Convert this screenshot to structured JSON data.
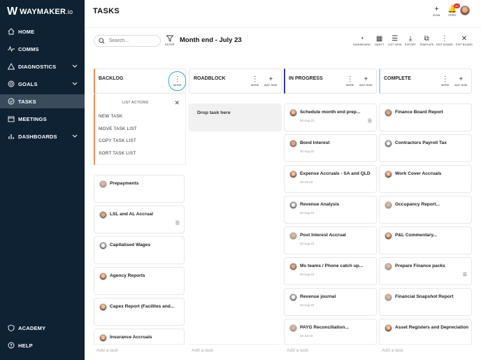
{
  "app": {
    "logo_mark": "W",
    "logo_name": "WAYMAKER",
    "logo_suffix": ".io"
  },
  "sidebar": {
    "items": [
      {
        "label": "HOME",
        "icon": "home-icon"
      },
      {
        "label": "COMMS",
        "icon": "pulse-icon"
      },
      {
        "label": "DIAGNOSTICS",
        "icon": "triangle-icon"
      },
      {
        "label": "GOALS",
        "icon": "target-icon"
      },
      {
        "label": "TASKS",
        "icon": "check-icon",
        "active": true
      },
      {
        "label": "MEETINGS",
        "icon": "calendar-icon"
      },
      {
        "label": "DASHBOARDS",
        "icon": "bar-chart-icon"
      },
      {
        "label": "ACADEMY",
        "icon": "shield-icon"
      },
      {
        "label": "HELP",
        "icon": "help-icon"
      }
    ]
  },
  "header": {
    "title": "TASKS",
    "goal_label": "GOAL",
    "feed_label": "FEED",
    "feed_badge": "62"
  },
  "toolbar": {
    "search_placeholder": "Search...",
    "filter_label": "FILTER",
    "board_title": "Month end - July 23",
    "tools": [
      "DASHBOARD",
      "GANTT",
      "LIST VIEW",
      "EXPORT",
      "TEMPLATE",
      "EDIT BOARD",
      "EXIT BOARD"
    ]
  },
  "columns": [
    {
      "name": "BACKLOG",
      "more": "MORE",
      "color": "#e8905a"
    },
    {
      "name": "ROADBLOCK",
      "more": "MORE",
      "add": "ADD TASK",
      "color": "#ffffff"
    },
    {
      "name": "IN PROGRESS",
      "more": "MORE",
      "add": "ADD TASK",
      "color": "#3b3a8f"
    },
    {
      "name": "COMPLETE",
      "more": "MORE",
      "add": "ADD TASK",
      "color": "#9fd6ea"
    }
  ],
  "list_actions": {
    "header": "LIST ACTIONS",
    "items": [
      "NEW TASK",
      "MOVE TASK LIST",
      "COPY TASK LIST",
      "SORT TASK LIST"
    ]
  },
  "backlog_cards": [
    {
      "title": "Prepayments",
      "date": ""
    },
    {
      "title": "LSL and AL Accrual",
      "date": ""
    },
    {
      "title": "Capitalised Wages",
      "date": ""
    },
    {
      "title": "Agency Reports",
      "date": ""
    },
    {
      "title": "Capex Report (Facilites and...",
      "date": ""
    },
    {
      "title": "Insurance Accruals",
      "date": ""
    }
  ],
  "roadblock": {
    "drop_text": "Drop task here"
  },
  "in_progress_cards": [
    {
      "title": "Schedule month end prep...",
      "date": "05 Aug 23"
    },
    {
      "title": "Bond Interest",
      "date": "30 Aug 23"
    },
    {
      "title": "Expense Accruals - SA and QLD",
      "date": "28 Jul 23"
    },
    {
      "title": "Revenue Analysis",
      "date": "02 Aug 23"
    },
    {
      "title": "Post Interest Accrual",
      "date": "02 Aug 23"
    },
    {
      "title": "Ms teams / Phone catch up...",
      "date": "06 Aug 23"
    },
    {
      "title": "Revenue journal",
      "date": "04 Aug 23"
    },
    {
      "title": "PAYG Reconciliation...",
      "date": "28 Jul 23"
    }
  ],
  "complete_cards": [
    {
      "title": "Finance Board Report",
      "date": ""
    },
    {
      "title": "Contractors Payroll Tax",
      "date": ""
    },
    {
      "title": "Work Cover Accruals",
      "date": ""
    },
    {
      "title": "Occupancy Report...",
      "date": ""
    },
    {
      "title": "P&L Commentary...",
      "date": ""
    },
    {
      "title": "Prepare Finance packs",
      "date": ""
    },
    {
      "title": "Financial Snapshot Report",
      "date": ""
    },
    {
      "title": "Asset Registers and Depreciation",
      "date": ""
    }
  ],
  "add_task_label": "Add a task"
}
